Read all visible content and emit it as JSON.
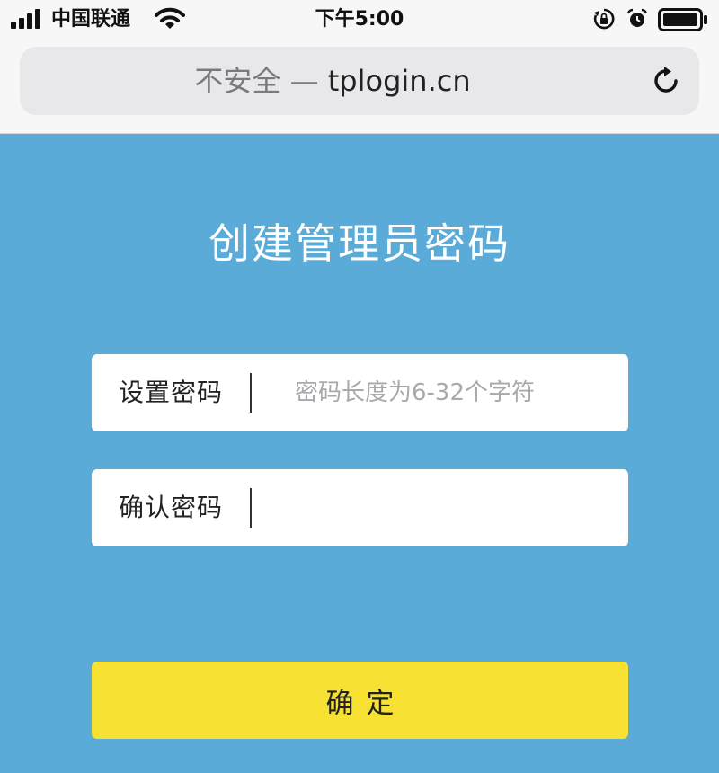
{
  "status_bar": {
    "carrier": "中国联通",
    "time": "下午5:00",
    "icons": [
      "signal-icon",
      "wifi-icon",
      "lock-rotation-icon",
      "alarm-icon",
      "battery-icon"
    ]
  },
  "browser": {
    "security_label": "不安全",
    "separator": "—",
    "domain": "tplogin.cn",
    "reload_icon": "reload-icon"
  },
  "page": {
    "title": "创建管理员密码",
    "set_password": {
      "label": "设置密码",
      "placeholder": "密码长度为6-32个字符",
      "value": ""
    },
    "confirm_password": {
      "label": "确认密码",
      "placeholder": "",
      "value": ""
    },
    "confirm_button": "确定"
  },
  "colors": {
    "background": "#5aabd8",
    "button": "#f7e234",
    "field": "#ffffff",
    "chrome": "#f7f7f8"
  }
}
